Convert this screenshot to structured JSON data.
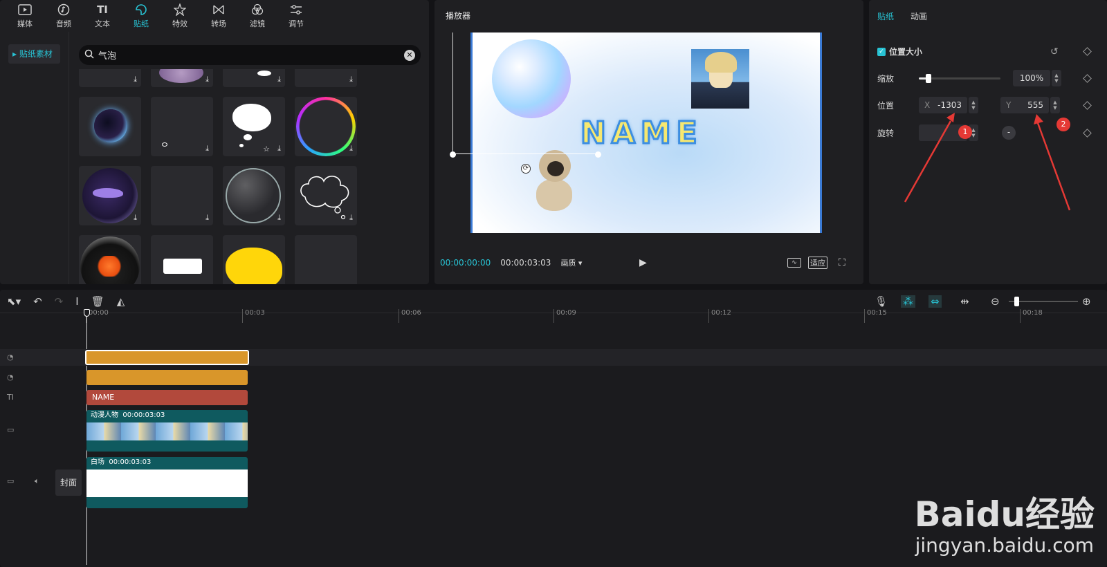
{
  "media_library": {
    "tabs": [
      {
        "label": "媒体",
        "icon": "media-icon"
      },
      {
        "label": "音频",
        "icon": "audio-icon"
      },
      {
        "label": "文本",
        "icon": "text-icon"
      },
      {
        "label": "贴纸",
        "icon": "sticker-icon",
        "active": true
      },
      {
        "label": "特效",
        "icon": "effects-icon"
      },
      {
        "label": "转场",
        "icon": "transition-icon"
      },
      {
        "label": "滤镜",
        "icon": "filter-icon"
      },
      {
        "label": "调节",
        "icon": "adjust-icon"
      }
    ],
    "side_item": "贴纸素材",
    "search_value": "气泡",
    "stickers": [
      "bubble",
      "bubble",
      "speech-bubble",
      "bubble",
      "glow-bubble",
      "small-bubble",
      "cloud-bubble",
      "rainbow-bubble",
      "dolphin-bubble",
      "empty",
      "clear-bubble",
      "cloud-outline",
      "fish-bubble",
      "white-box",
      "yellow-cloud",
      "empty"
    ]
  },
  "player": {
    "title": "播放器",
    "canvas_text": "NAME",
    "current_time": "00:00:00:00",
    "total_time": "00:00:03:03",
    "quality_label": "画质",
    "fit_label": "适应"
  },
  "properties": {
    "tabs": [
      "贴纸",
      "动画"
    ],
    "section": "位置大小",
    "scale_label": "缩放",
    "scale_value": "100%",
    "scale_level": 0.12,
    "position_label": "位置",
    "x_label": "X",
    "x_value": "-1303",
    "y_label": "Y",
    "y_value": "555",
    "rotate_label": "旋转",
    "rotate_dash": "-",
    "badge_1": "1",
    "badge_2": "2"
  },
  "timeline": {
    "ruler": [
      "00:00",
      "00:03",
      "00:06",
      "00:09",
      "00:12",
      "00:15",
      "00:18"
    ],
    "text_clip": "NAME",
    "video_clip_label": "动漫人物",
    "video_clip_time": "00:00:03:03",
    "bg_clip_label": "白场",
    "bg_clip_time": "00:00:03:03",
    "cover_label": "封面",
    "track_text_icon": "TI"
  },
  "watermark": {
    "brand": "Baidu经验",
    "url": "jingyan.baidu.com"
  },
  "colors": {
    "accent": "#28c3d4",
    "sticker_clip": "#d9962a",
    "text_clip": "#b2493c",
    "video_clip": "#0f5a5f"
  }
}
